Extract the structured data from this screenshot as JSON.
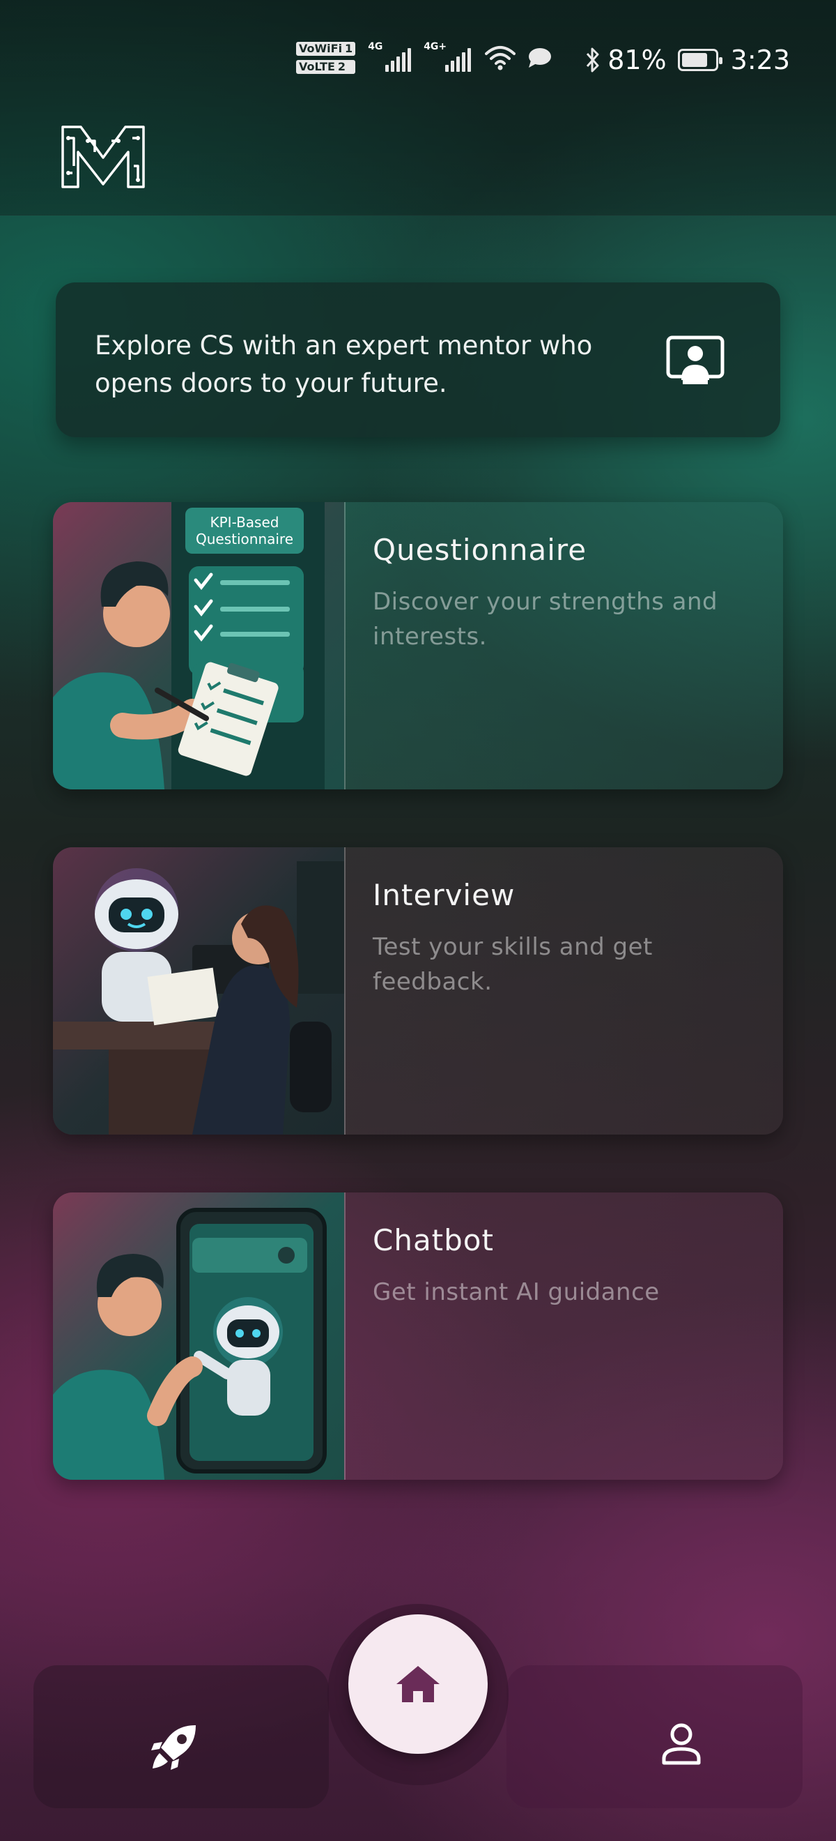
{
  "status_bar": {
    "sim1_label": "VoWiFi",
    "sim1_num": "1",
    "sim2_label": "VoLTE",
    "sim2_num": "2",
    "signal1_type": "4G",
    "signal2_type": "4G+",
    "battery_percent": "81%",
    "battery_level": 0.81,
    "time": "3:23",
    "icons": [
      "bluetooth-icon",
      "wifi-icon",
      "message-icon",
      "battery-saver-icon"
    ]
  },
  "header": {
    "logo_icon": "circuit-m-logo"
  },
  "intro": {
    "text": "Explore CS with an expert mentor who opens doors to your future.",
    "icon": "mentor-screen-icon"
  },
  "cards": [
    {
      "title": "Questionnaire",
      "description": "Discover your strengths and interests.",
      "image_sign_text": "KPI-Based Questionnaire",
      "image_sign_line1": "KPI-Based",
      "image_sign_line2": "Questionnaire"
    },
    {
      "title": "Interview",
      "description": "Test your skills and get feedback."
    },
    {
      "title": "Chatbot",
      "description": "Get instant AI guidance"
    }
  ],
  "bottom_nav": {
    "items": [
      "rocket-icon",
      "home-icon",
      "profile-icon"
    ],
    "active": "home-icon"
  },
  "colors": {
    "home_button_bg": "#f6e9f0",
    "home_icon": "#6a2c58",
    "teal_accent": "#1f7a6d"
  }
}
